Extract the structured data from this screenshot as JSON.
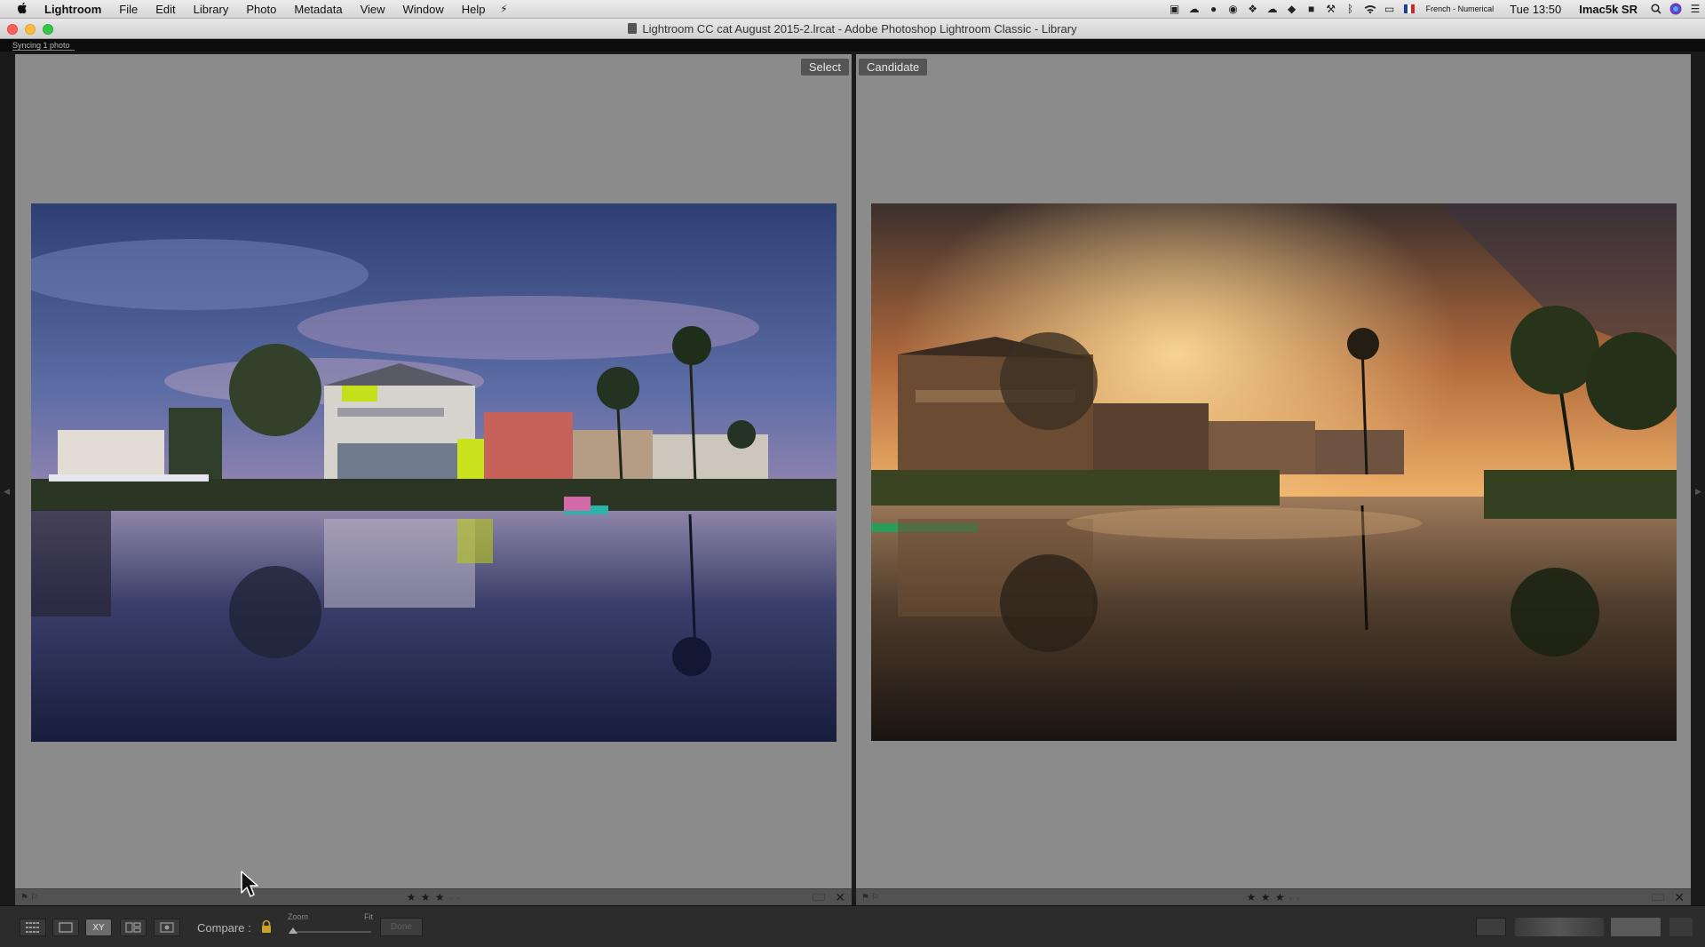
{
  "menubar": {
    "apple_symbol": "",
    "app_name": "Lightroom",
    "menus": [
      "File",
      "Edit",
      "Library",
      "Photo",
      "Metadata",
      "View",
      "Window",
      "Help"
    ],
    "status_icons": [
      "screenshot-icon",
      "creative-cloud-icon",
      "droplet-icon",
      "sync-icon",
      "dropbox-icon",
      "cloud-icon",
      "evernote-icon",
      "backup-icon",
      "wrench-icon",
      "bluetooth-icon",
      "wifi-icon",
      "airplay-icon"
    ],
    "input_source": "French - Numerical",
    "clock": "Tue 13:50",
    "user": "Imac5k SR"
  },
  "window": {
    "title": "Lightroom CC cat August 2015-2.lrcat - Adobe Photoshop Lightroom Classic - Library"
  },
  "activity": {
    "status": "Syncing 1 photo"
  },
  "compare": {
    "select_label": "Select",
    "candidate_label": "Candidate",
    "left_rating": 3,
    "right_rating": 3
  },
  "toolbar": {
    "compare_label": "Compare :",
    "zoom_label": "Zoom",
    "fit_label": "Fit",
    "swap_label": "Done",
    "view_buttons": [
      "grid-view-icon",
      "loupe-view-icon",
      "compare-view-icon",
      "survey-view-icon",
      "people-view-icon"
    ],
    "active_view": "compare-view-icon",
    "compare_view_text": "XY"
  },
  "colors": {
    "pane_background": "#8b8b8b",
    "chrome_dark": "#1a1a1a",
    "accent_lock": "#c9a227"
  }
}
